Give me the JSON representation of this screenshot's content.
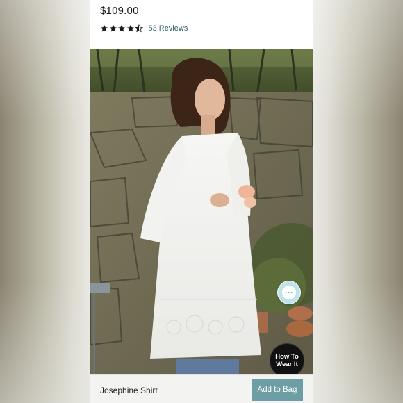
{
  "product": {
    "price": "$109.00",
    "rating": 4.5,
    "rating_max": 5,
    "reviews_label": "53 Reviews",
    "name": "Josephine Shirt"
  },
  "actions": {
    "add_to_bag_label": "Add to Bag",
    "how_to_wear_line1": "How To",
    "how_to_wear_line2": "Wear It",
    "chat_glyph": "···"
  },
  "icons": {
    "star": "star-icon",
    "half_star": "half-star-icon",
    "chat": "chat-icon"
  },
  "colors": {
    "accent": "#6d9da5",
    "link": "#2e5e68",
    "chat_bubble": "#bfe3e8",
    "howto_bg": "#111111"
  }
}
